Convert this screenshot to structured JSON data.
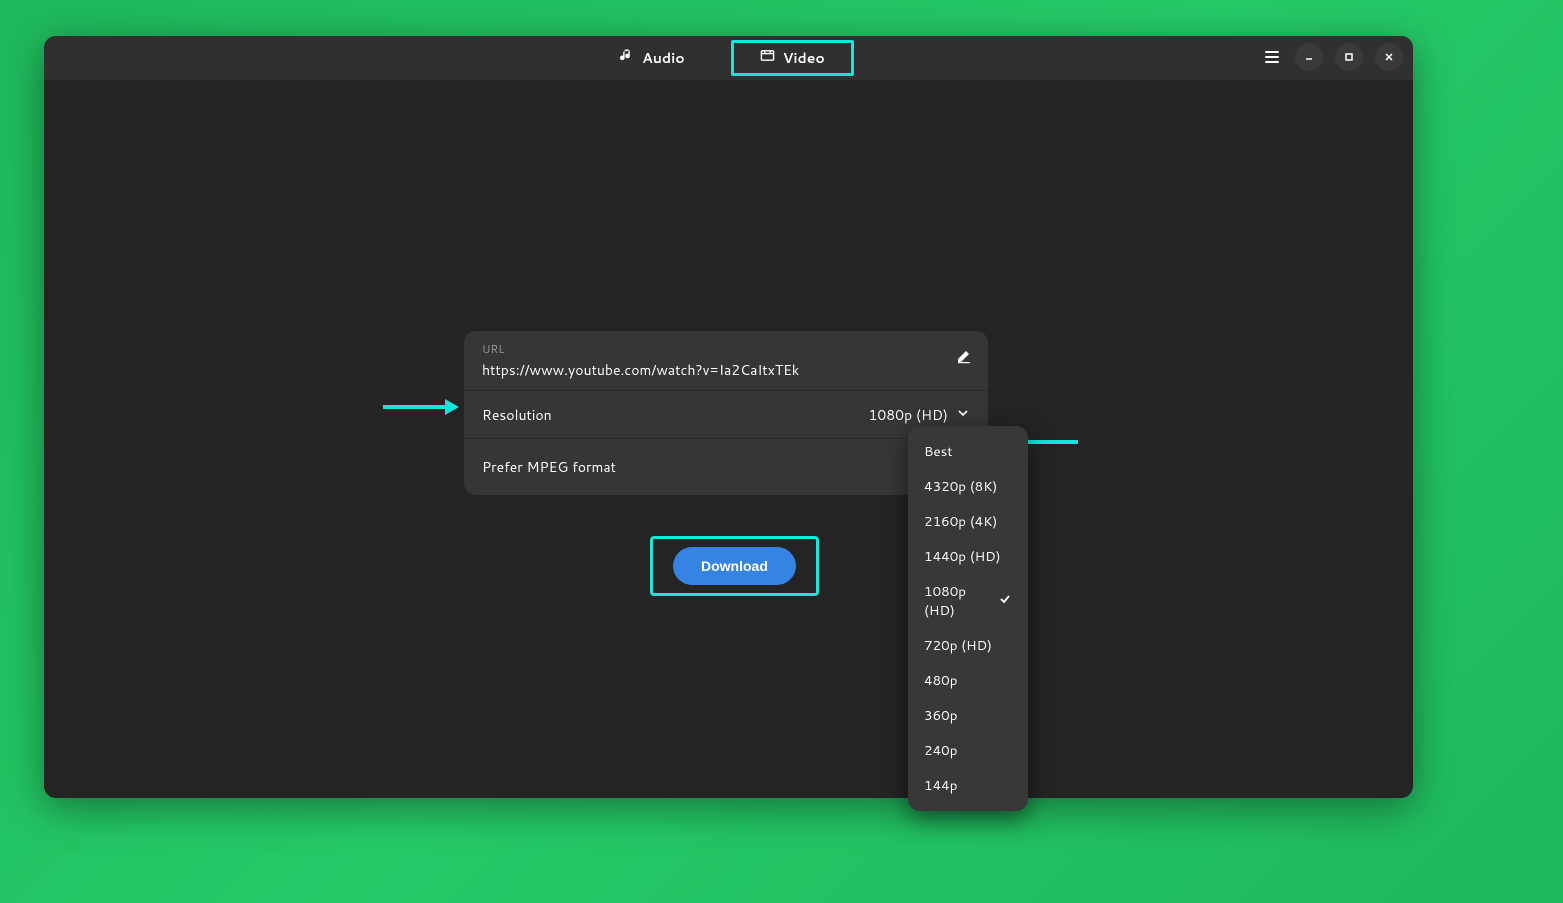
{
  "tabs": {
    "audio_label": "Audio",
    "video_label": "Video"
  },
  "form": {
    "url_label": "URL",
    "url_value": "https://www.youtube.com/watch?v=Ia2CaItxTEk",
    "resolution_label": "Resolution",
    "resolution_value": "1080p (HD)",
    "mpeg_label": "Prefer MPEG format"
  },
  "download_label": "Download",
  "resolution_options": [
    "Best",
    "4320p (8K)",
    "2160p (4K)",
    "1440p (HD)",
    "1080p (HD)",
    "720p (HD)",
    "480p",
    "360p",
    "240p",
    "144p"
  ],
  "selected_resolution": "1080p (HD)"
}
